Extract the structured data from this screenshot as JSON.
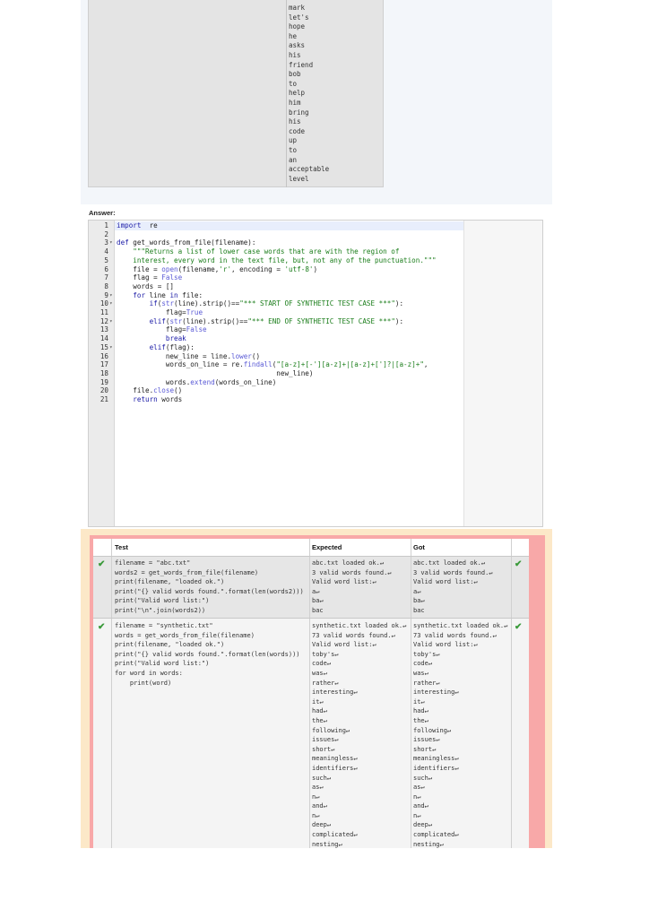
{
  "expected_words": [
    "mark",
    "let's",
    "hope",
    "he",
    "asks",
    "his",
    "friend",
    "bob",
    "to",
    "help",
    "him",
    "bring",
    "his",
    "code",
    "up",
    "to",
    "an",
    "acceptable",
    "level"
  ],
  "answer": {
    "label": "Answer:",
    "code_lines": [
      {
        "n": "1",
        "fold": "",
        "src": [
          [
            "kw",
            "import"
          ],
          [
            "",
            "  re"
          ]
        ]
      },
      {
        "n": "2",
        "fold": "",
        "src": []
      },
      {
        "n": "3",
        "fold": "▾",
        "src": [
          [
            "kw",
            "def"
          ],
          [
            "",
            " get_words_from_file(filename):"
          ]
        ]
      },
      {
        "n": "4",
        "fold": "",
        "src": [
          [
            "str",
            "    \"\"\"Returns a list of lower case words that are with the region of"
          ]
        ]
      },
      {
        "n": "5",
        "fold": "",
        "src": [
          [
            "str",
            "    interest, every word in the text file, but, not any of the punctuation.\"\"\""
          ]
        ]
      },
      {
        "n": "6",
        "fold": "",
        "src": [
          [
            "",
            "    file = "
          ],
          [
            "fn",
            "open"
          ],
          [
            "",
            "(filename,"
          ],
          [
            "str",
            "'r'"
          ],
          [
            ", encoding = ",
            ""
          ],
          [
            "str",
            "'utf-8'"
          ],
          [
            "",
            ")"
          ]
        ]
      },
      {
        "n": "7",
        "fold": "",
        "src": [
          [
            "",
            "    flag = "
          ],
          [
            "cst",
            "False"
          ]
        ]
      },
      {
        "n": "8",
        "fold": "",
        "src": [
          [
            "",
            "    words = []"
          ]
        ]
      },
      {
        "n": "9",
        "fold": "▾",
        "src": [
          [
            "",
            "    "
          ],
          [
            "kw",
            "for"
          ],
          [
            "",
            " line "
          ],
          [
            "kw",
            "in"
          ],
          [
            "",
            " file:"
          ]
        ]
      },
      {
        "n": "10",
        "fold": "▾",
        "src": [
          [
            "",
            "        "
          ],
          [
            "kw",
            "if"
          ],
          [
            "",
            "("
          ],
          [
            "fn",
            "str"
          ],
          [
            "",
            "(line).strip()=="
          ],
          [
            "str",
            "\"*** START OF SYNTHETIC TEST CASE ***\""
          ],
          [
            "",
            "):"
          ]
        ]
      },
      {
        "n": "11",
        "fold": "",
        "src": [
          [
            "",
            "            flag="
          ],
          [
            "cst",
            "True"
          ]
        ]
      },
      {
        "n": "12",
        "fold": "▾",
        "src": [
          [
            "",
            "        "
          ],
          [
            "kw",
            "elif"
          ],
          [
            "",
            "("
          ],
          [
            "fn",
            "str"
          ],
          [
            "",
            "(line).strip()=="
          ],
          [
            "str",
            "\"*** END OF SYNTHETIC TEST CASE ***\""
          ],
          [
            "",
            "):"
          ]
        ]
      },
      {
        "n": "13",
        "fold": "",
        "src": [
          [
            "",
            "            flag="
          ],
          [
            "cst",
            "False"
          ]
        ]
      },
      {
        "n": "14",
        "fold": "",
        "src": [
          [
            "",
            "            "
          ],
          [
            "kw",
            "break"
          ]
        ]
      },
      {
        "n": "15",
        "fold": "▾",
        "src": [
          [
            "",
            "        "
          ],
          [
            "kw",
            "elif"
          ],
          [
            "",
            "(flag):"
          ]
        ]
      },
      {
        "n": "16",
        "fold": "",
        "src": [
          [
            "",
            "            new_line = line."
          ],
          [
            "fn",
            "lower"
          ],
          [
            "",
            "()"
          ]
        ]
      },
      {
        "n": "17",
        "fold": "",
        "src": [
          [
            "",
            "            words_on_line = re."
          ],
          [
            "fn",
            "findall"
          ],
          [
            "",
            "("
          ],
          [
            "str",
            "\"[a-z]+[-'][a-z]+|[a-z]+[']?|[a-z]+\""
          ],
          [
            "",
            ","
          ]
        ]
      },
      {
        "n": "18",
        "fold": "",
        "src": [
          [
            "",
            "                                       new_line)"
          ]
        ]
      },
      {
        "n": "19",
        "fold": "",
        "src": [
          [
            "",
            "            words."
          ],
          [
            "fn",
            "extend"
          ],
          [
            "",
            "(words_on_line)"
          ]
        ]
      },
      {
        "n": "20",
        "fold": "",
        "src": [
          [
            "",
            "    file."
          ],
          [
            "fn",
            "close"
          ],
          [
            "",
            "()"
          ]
        ]
      },
      {
        "n": "21",
        "fold": "",
        "src": [
          [
            "",
            "    "
          ],
          [
            "kw",
            "return"
          ],
          [
            "",
            " words"
          ]
        ]
      }
    ]
  },
  "results": {
    "headers": {
      "test": "Test",
      "expected": "Expected",
      "got": "Got"
    },
    "rows": [
      {
        "test": "filename = \"abc.txt\"\nwords2 = get_words_from_file(filename)\nprint(filename, \"loaded ok.\")\nprint(\"{} valid words found.\".format(len(words2)))\nprint(\"Valid word list:\")\nprint(\"\\n\".join(words2))",
        "expected": "abc.txt loaded ok.↵\n3 valid words found.↵\nValid word list:↵\na↵\nba↵\nbac",
        "got": "abc.txt loaded ok.↵\n3 valid words found.↵\nValid word list:↵\na↵\nba↵\nbac",
        "status": "✔"
      },
      {
        "test": "filename = \"synthetic.txt\"\nwords = get_words_from_file(filename)\nprint(filename, \"loaded ok.\")\nprint(\"{} valid words found.\".format(len(words)))\nprint(\"Valid word list:\")\nfor word in words:\n    print(word)",
        "expected": "synthetic.txt loaded ok.↵\n73 valid words found.↵\nValid word list:↵\ntoby's↵\ncode↵\nwas↵\nrather↵\ninteresting↵\nit↵\nhad↵\nthe↵\nfollowing↵\nissues↵\nshort↵\nmeaningless↵\nidentifiers↵\nsuch↵\nas↵\nn↵\nand↵\nn↵\ndeep↵\ncomplicated↵\nnesting↵",
        "got": "synthetic.txt loaded ok.↵\n73 valid words found.↵\nValid word list:↵\ntoby's↵\ncode↵\nwas↵\nrather↵\ninteresting↵\nit↵\nhad↵\nthe↵\nfollowing↵\nissues↵\nshort↵\nmeaningless↵\nidentifiers↵\nsuch↵\nas↵\nn↵\nand↵\nn↵\ndeep↵\ncomplicated↵\nnesting↵",
        "status": "✔"
      }
    ]
  },
  "colors": {
    "pass": "#3a9a3a",
    "fail_border": "#f8a8a8",
    "outer": "#fce8c8"
  }
}
